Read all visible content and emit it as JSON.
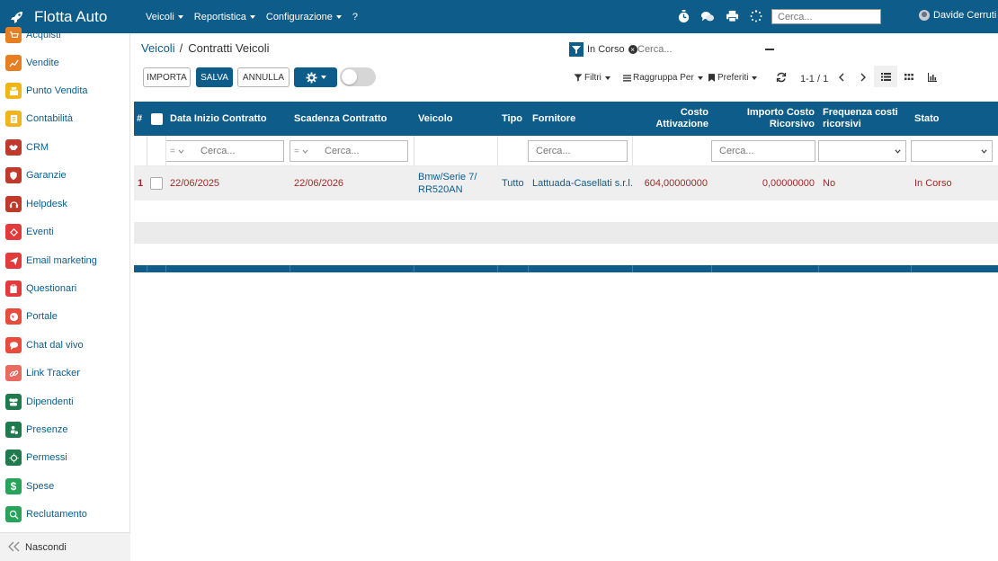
{
  "app": {
    "title": "Flotta Auto"
  },
  "topnav": [
    {
      "label": "Veicoli",
      "dropdown": true
    },
    {
      "label": "Reportistica",
      "dropdown": true
    },
    {
      "label": "Configurazione",
      "dropdown": true
    },
    {
      "label": "?",
      "dropdown": false
    }
  ],
  "top_search": {
    "placeholder": "Cerca..."
  },
  "user": {
    "name": "Davide Cerruti"
  },
  "sidebar": {
    "items": [
      {
        "label": "Acquisti",
        "icon": "cart-icon",
        "color": "#e67e22"
      },
      {
        "label": "Vendite",
        "icon": "chart-line-icon",
        "color": "#e67e22"
      },
      {
        "label": "Punto Vendita",
        "icon": "register-icon",
        "color": "#f1b51c"
      },
      {
        "label": "Contabilità",
        "icon": "ledger-icon",
        "color": "#f1b51c"
      },
      {
        "label": "CRM",
        "icon": "handshake-icon",
        "color": "#c0392b"
      },
      {
        "label": "Garanzie",
        "icon": "shield-icon",
        "color": "#c0392b"
      },
      {
        "label": "Helpdesk",
        "icon": "headset-icon",
        "color": "#c0392b"
      },
      {
        "label": "Eventi",
        "icon": "ticket-icon",
        "color": "#e23b3b"
      },
      {
        "label": "Email marketing",
        "icon": "paper-plane-icon",
        "color": "#e23b3b"
      },
      {
        "label": "Questionari",
        "icon": "clipboard-icon",
        "color": "#e23b3b"
      },
      {
        "label": "Portale",
        "icon": "globe-icon",
        "color": "#e74c3c"
      },
      {
        "label": "Chat dal vivo",
        "icon": "chat-icon",
        "color": "#e74c3c"
      },
      {
        "label": "Link Tracker",
        "icon": "link-icon",
        "color": "#e96b60"
      },
      {
        "label": "Dipendenti",
        "icon": "users-icon",
        "color": "#1f7a4d"
      },
      {
        "label": "Presenze",
        "icon": "user-clock-icon",
        "color": "#1f7a4d"
      },
      {
        "label": "Permessi",
        "icon": "sun-icon",
        "color": "#1f7a4d"
      },
      {
        "label": "Spese",
        "icon": "dollar-icon",
        "color": "#27a35a"
      },
      {
        "label": "Reclutamento",
        "icon": "search-user-icon",
        "color": "#27a35a"
      }
    ],
    "hide_label": "Nascondi"
  },
  "breadcrumb": {
    "parent": "Veicoli",
    "separator": "/",
    "current": "Contratti Veicoli"
  },
  "search": {
    "facet_label": "In Corso",
    "placeholder": "Cerca..."
  },
  "toolbar": {
    "import_label": "IMPORTA",
    "save_label": "SALVA",
    "cancel_label": "ANNULLA"
  },
  "controls": {
    "filters_label": "Filtri",
    "groupby_label": "Raggruppa Per",
    "favorites_label": "Preferiti",
    "pager": "1-1 / 1"
  },
  "table": {
    "headers": {
      "num": "#",
      "start": "Data Inizio Contratto",
      "end": "Scadenza Contratto",
      "vehicle": "Veicolo",
      "type": "Tipo",
      "supplier": "Fornitore",
      "activation_cost_1": "Costo",
      "activation_cost_2": "Attivazione",
      "recurring_1": "Importo Costo",
      "recurring_2": "Ricorsivo",
      "frequency_1": "Frequenza costi",
      "frequency_2": "ricorsivi",
      "state": "Stato"
    },
    "filters": {
      "operator": "=",
      "search_placeholder": "Cerca..."
    },
    "rows": [
      {
        "num": "1",
        "start": "22/06/2025",
        "end": "22/06/2026",
        "vehicle_1": "Bmw/Serie 7/",
        "vehicle_2": "RR520AN",
        "type": "Tutto",
        "supplier": "Lattuada-Casellati s.r.l.",
        "activation_cost": "604,00000000",
        "recurring": "0,00000000",
        "frequency": "No",
        "state": "In Corso"
      }
    ]
  },
  "colors": {
    "primary": "#0d5c8a",
    "row_text": "#a02a2a"
  }
}
